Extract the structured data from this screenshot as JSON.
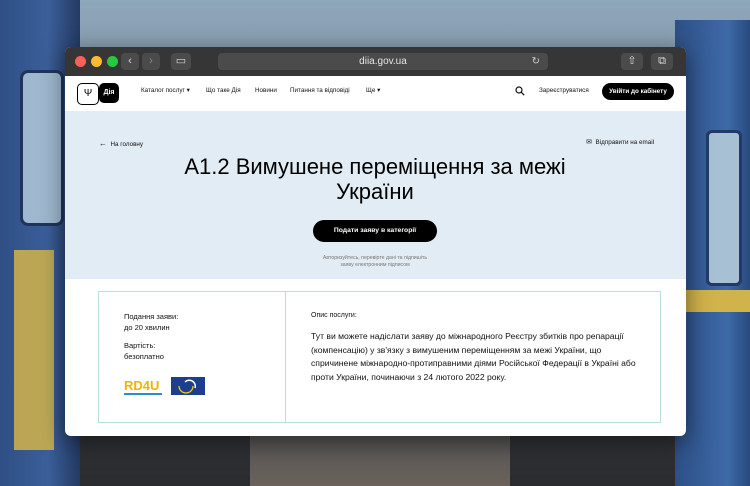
{
  "browser": {
    "url": "diia.gov.ua"
  },
  "nav": {
    "logo_label": "Дія",
    "items": [
      "Каталог послуг",
      "Що таке Дія",
      "Новини",
      "Питання та відповіді",
      "Ще"
    ],
    "register": "Зареєструватися",
    "login": "Увійти до кабінету"
  },
  "hero": {
    "back": "На головну",
    "email": "Відправити на email",
    "title_line1": "А1.2 Вимушене переміщення за межі",
    "title_line2": "України",
    "apply_button": "Подати заяву в категорії",
    "auth_note_line1": "Авторизуйтесь, перевірте дані та підпишіть",
    "auth_note_line2": "заяву електронним підписом"
  },
  "card": {
    "time_label": "Подання заяви:",
    "time_value": "до 20 хвилин",
    "price_label": "Вартість:",
    "price_value": "безоплатно",
    "logo1_text": "RD4U",
    "desc_label": "Опис послуги:",
    "description": "Тут ви можете надіслати заяву до міжнародного Реєстру збитків про репарації (компенсацію) у зв'язку з вимушеним переміщенням за межі України, що спричинене міжнародно-протиправними діями Російської Федерації в Україні або проти України, починаючи з 24 лютого 2022 року."
  },
  "colors": {
    "hero_bg": "#e2ecf4",
    "card_border": "#b9dee0",
    "accent_black": "#000000"
  }
}
